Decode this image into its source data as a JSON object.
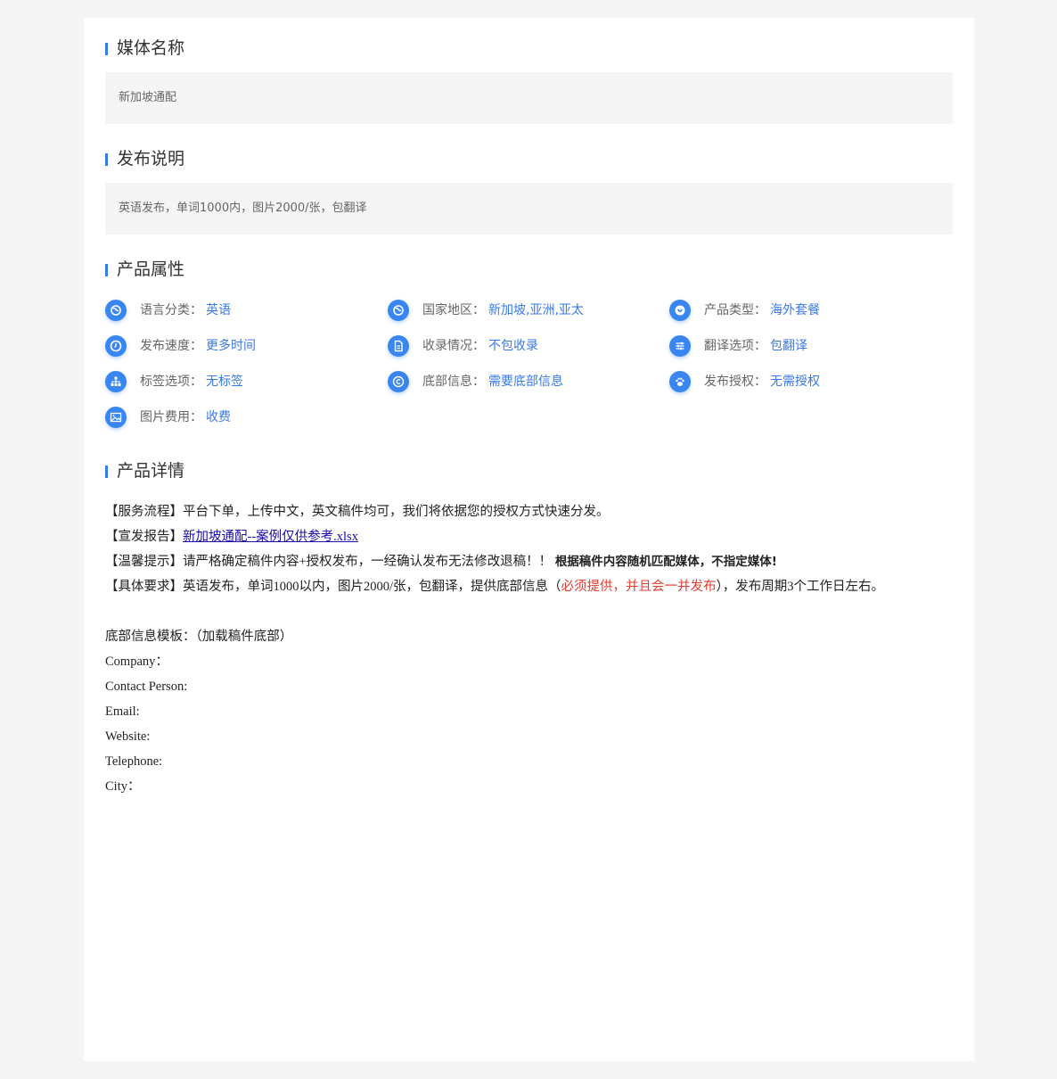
{
  "sections": {
    "media_name": {
      "title": "媒体名称",
      "value": "新加坡通配"
    },
    "publish_note": {
      "title": "发布说明",
      "value": "英语发布，单词1000内，图片2000/张，包翻译"
    },
    "product_attrs": {
      "title": "产品属性",
      "items": [
        {
          "icon": "globe-icon",
          "label": "语言分类：",
          "value": "英语"
        },
        {
          "icon": "globe-icon",
          "label": "国家地区：",
          "value": "新加坡,亚洲,亚太"
        },
        {
          "icon": "chevron-down-icon",
          "label": "产品类型：",
          "value": "海外套餐"
        },
        {
          "icon": "clock-icon",
          "label": "发布速度：",
          "value": "更多时间"
        },
        {
          "icon": "document-icon",
          "label": "收录情况：",
          "value": "不包收录"
        },
        {
          "icon": "sliders-icon",
          "label": "翻译选项：",
          "value": "包翻译"
        },
        {
          "icon": "sitemap-icon",
          "label": "标签选项：",
          "value": "无标签"
        },
        {
          "icon": "copyright-icon",
          "label": "底部信息：",
          "value": "需要底部信息"
        },
        {
          "icon": "paw-icon",
          "label": "发布授权：",
          "value": "无需授权"
        },
        {
          "icon": "image-icon",
          "label": "图片费用：",
          "value": "收费"
        }
      ]
    },
    "product_details": {
      "title": "产品详情",
      "service_label": "【服务流程】",
      "service_text": "平台下单，上传中文，英文稿件均可，我们将依据您的授权方式快速分发。",
      "report_label": "【宣发报告】",
      "report_link": "新加坡通配--案例仅供参考.xlsx",
      "tip_label": "【温馨提示】",
      "tip_text": "请严格确定稿件内容+授权发布，一经确认发布无法修改退稿！！",
      "tip_bold": "根据稿件内容随机匹配媒体，不指定媒体!",
      "req_label": "【具体要求】",
      "req_text_1": "英语发布，单词1000以内，图片2000/张，包翻译，提供底部信息（",
      "req_red": "必须提供，并且会一并发布",
      "req_text_2": "），发布周期3个工作日左右。",
      "template_title": "底部信息模板：（加载稿件底部）",
      "template_fields": [
        "Company：",
        "Contact Person:",
        "Email:",
        "Website:",
        "Telephone:",
        "City："
      ]
    }
  },
  "colors": {
    "accent": "#3a7ae6",
    "icon_bg": "#3a86f0",
    "box_bg": "#f5f5f5",
    "warning_red": "#e03c31"
  }
}
